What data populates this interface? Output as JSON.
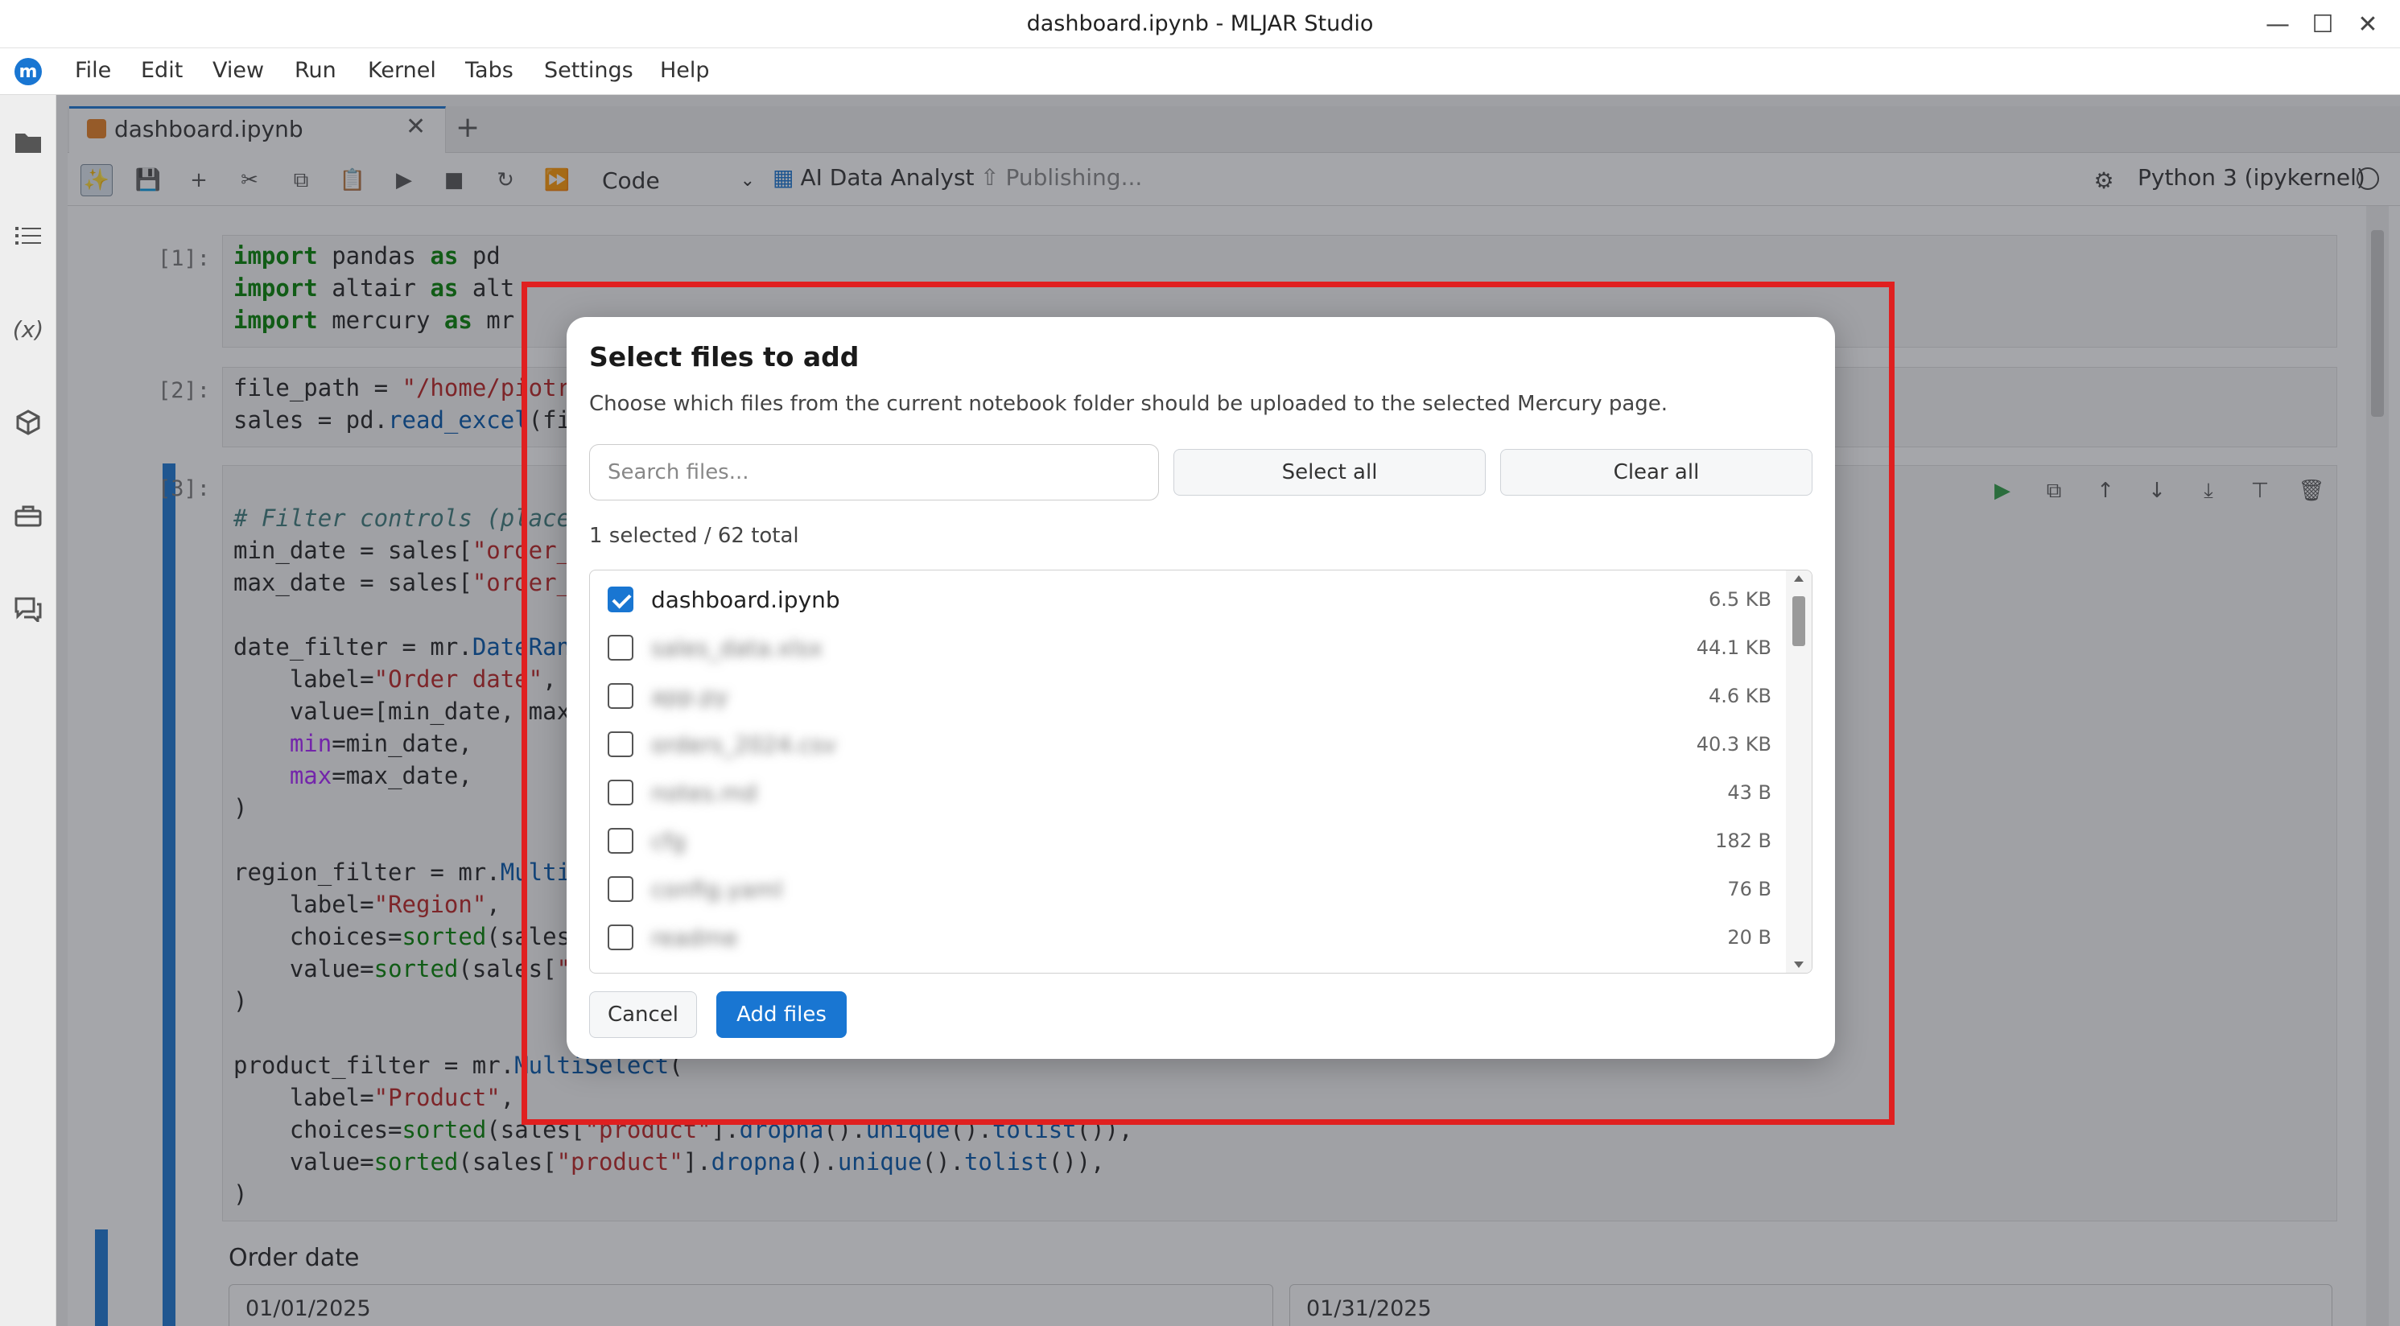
{
  "window": {
    "title": "dashboard.ipynb - MLJAR Studio",
    "controls": [
      "minimize-icon",
      "maximize-icon",
      "close-icon"
    ]
  },
  "menubar": {
    "logo": "m",
    "items": [
      "File",
      "Edit",
      "View",
      "Run",
      "Kernel",
      "Tabs",
      "Settings",
      "Help"
    ]
  },
  "sidebar": {
    "icons": [
      "folder-icon",
      "table-of-contents-icon",
      "variables-icon",
      "extensions-icon",
      "toolbox-icon",
      "chat-icon"
    ],
    "variables_glyph": "(x)"
  },
  "tabs": [
    {
      "label": "dashboard.ipynb",
      "active": true
    }
  ],
  "toolbar": {
    "cell_type": "Code",
    "ai_analyst": "AI Data Analyst",
    "publishing": "Publishing...",
    "kernel": "Python 3 (ipykernel)"
  },
  "notebook": {
    "cells": [
      {
        "prompt": "[1]:"
      },
      {
        "prompt": "[2]:"
      },
      {
        "prompt": "[3]:"
      }
    ],
    "output": {
      "label": "Order date",
      "start_date": "01/01/2025",
      "end_date": "01/31/2025"
    }
  },
  "dialog": {
    "title": "Select files to add",
    "description": "Choose which files from the current notebook folder should be uploaded to the selected Mercury page.",
    "search_placeholder": "Search files...",
    "select_all": "Select all",
    "clear_all": "Clear all",
    "count": "1 selected / 62 total",
    "files": [
      {
        "name": "dashboard.ipynb",
        "size": "6.5 KB",
        "checked": true,
        "blurred": false
      },
      {
        "name": "sales_data.xlsx",
        "size": "44.1 KB",
        "checked": false,
        "blurred": true
      },
      {
        "name": "app.py",
        "size": "4.6 KB",
        "checked": false,
        "blurred": true
      },
      {
        "name": "orders_2024.csv",
        "size": "40.3 KB",
        "checked": false,
        "blurred": true
      },
      {
        "name": "notes.md",
        "size": "43 B",
        "checked": false,
        "blurred": true
      },
      {
        "name": "cfg",
        "size": "182 B",
        "checked": false,
        "blurred": true
      },
      {
        "name": "config.yaml",
        "size": "76 B",
        "checked": false,
        "blurred": true
      },
      {
        "name": "readme",
        "size": "20 B",
        "checked": false,
        "blurred": true
      }
    ],
    "cancel": "Cancel",
    "add": "Add files"
  },
  "colors": {
    "accent": "#1976d2",
    "highlight": "#e02020"
  }
}
